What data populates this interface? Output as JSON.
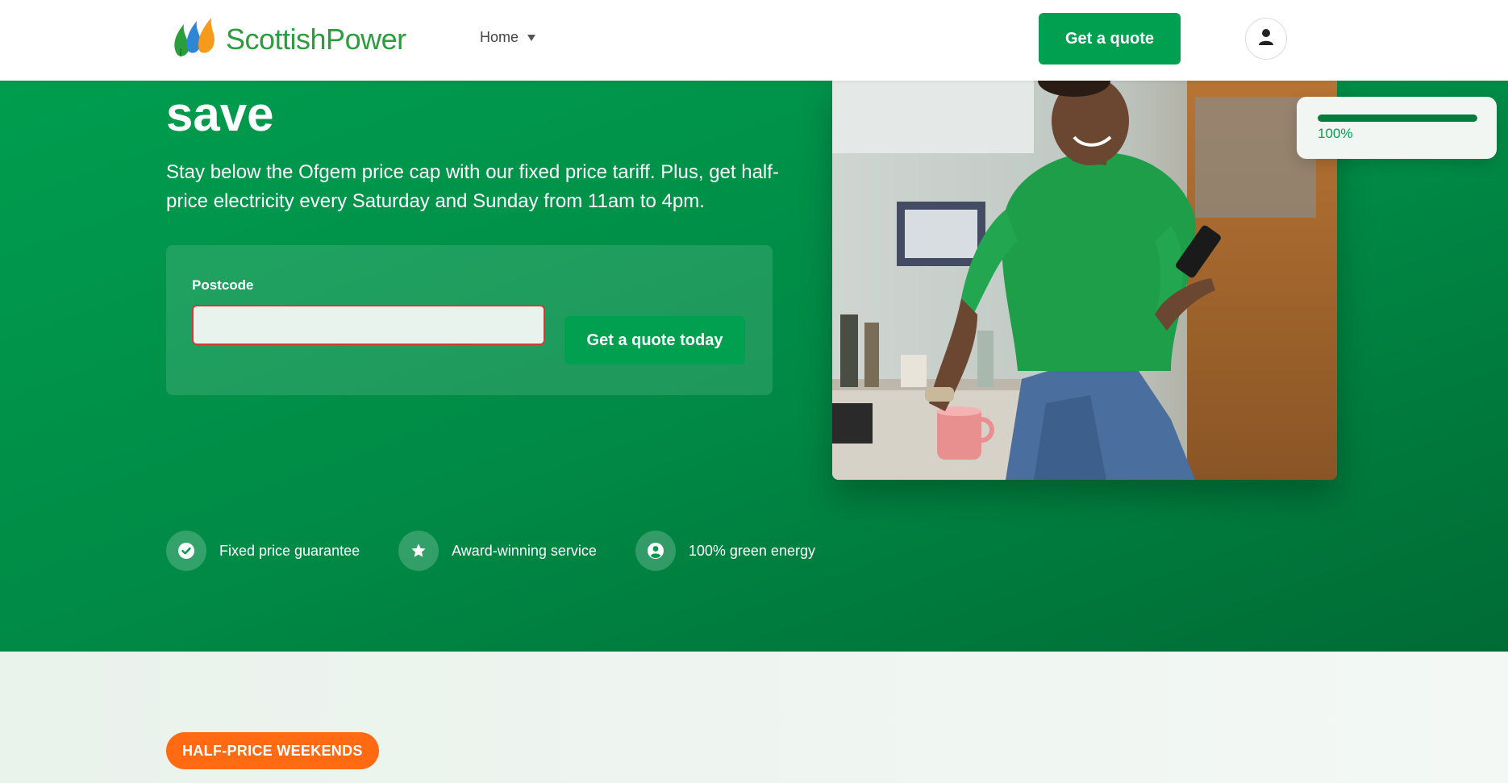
{
  "header": {
    "brand": "ScottishPower",
    "nav_home": "Home",
    "get_quote": "Get a quote"
  },
  "hero": {
    "title": "save",
    "description": "Stay below the Ofgem price cap with our fixed price tariff. Plus, get half-price electricity every Saturday and Sunday from 11am to 4pm.",
    "postcode_label": "Postcode",
    "postcode_value": "",
    "cta": "Get a quote today",
    "features": [
      {
        "icon": "check-circle-icon",
        "label": "Fixed price guarantee"
      },
      {
        "icon": "star-icon",
        "label": "Award-winning service"
      },
      {
        "icon": "user-circle-icon",
        "label": "100% green energy"
      }
    ]
  },
  "progress": {
    "value": 1.0,
    "label": "100%"
  },
  "lower": {
    "badge": "HALF-PRICE WEEKENDS"
  },
  "colors": {
    "brand_green": "#00a050",
    "dark_green": "#006b35",
    "badge_orange": "#ff6a13",
    "error_border": "#d23a3a"
  }
}
